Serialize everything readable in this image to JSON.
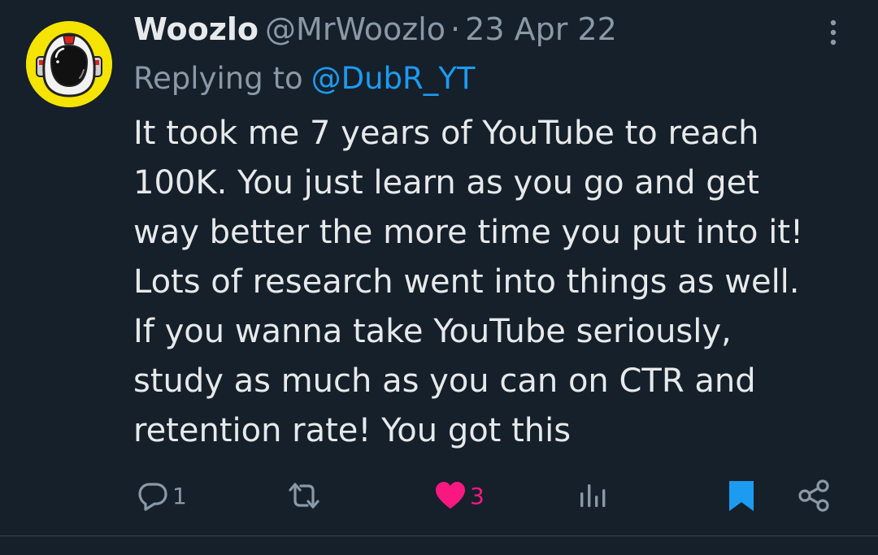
{
  "tweet": {
    "display_name": "Woozlo",
    "handle": "@MrWoozlo",
    "separator": "·",
    "date": "23 Apr 22",
    "replying_prefix": "Replying to",
    "replying_to": "@DubR_YT",
    "text_lines": [
      "It took me 7 years of YouTube to reach",
      "100K. You just learn as you go and get",
      "way better the more time you put into it!",
      "Lots of research went into things as well.",
      "If you wanna take YouTube seriously,",
      "study as much as you can on CTR and",
      "retention rate! You got this"
    ],
    "avatar": {
      "icon": "astronaut-helmet-icon",
      "background_color": "#f5e400"
    }
  },
  "actions": {
    "reply": {
      "icon": "reply-icon",
      "count": "1"
    },
    "retweet": {
      "icon": "retweet-icon",
      "count": ""
    },
    "like": {
      "icon": "heart-icon",
      "count": "3",
      "liked": true
    },
    "views": {
      "icon": "views-icon",
      "count": ""
    },
    "bookmark": {
      "icon": "bookmark-icon",
      "bookmarked": true
    },
    "share": {
      "icon": "share-icon"
    }
  },
  "colors": {
    "background": "#15202b",
    "text_primary": "#e7e9ea",
    "text_secondary": "#8b98a5",
    "link": "#1d9bf0",
    "like": "#f91880",
    "divider": "#38444d"
  }
}
